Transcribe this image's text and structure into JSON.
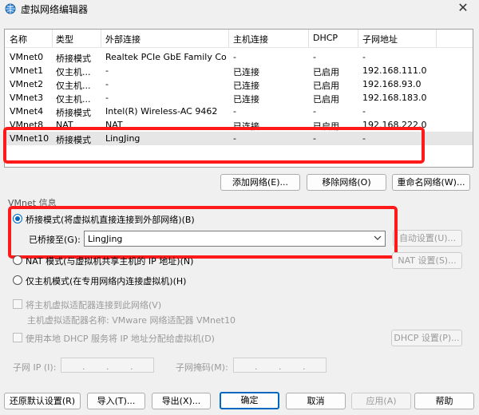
{
  "window": {
    "title": "虚拟网络编辑器",
    "icons": {
      "app": "network-globe-icon",
      "close": "close-icon"
    }
  },
  "table": {
    "headers": [
      "名称",
      "类型",
      "外部连接",
      "主机连接",
      "DHCP",
      "子网地址"
    ],
    "rows": [
      [
        "VMnet0",
        "桥接模式",
        "Realtek PCIe GbE Family Co...",
        "-",
        "-",
        "-"
      ],
      [
        "VMnet1",
        "仅主机...",
        "-",
        "已连接",
        "已启用",
        "192.168.111.0"
      ],
      [
        "VMnet2",
        "仅主机...",
        "-",
        "已连接",
        "已启用",
        "192.168.93.0"
      ],
      [
        "VMnet3",
        "仅主机...",
        "-",
        "已连接",
        "已启用",
        "192.168.183.0"
      ],
      [
        "VMnet4",
        "桥接模式",
        "Intel(R) Wireless-AC 9462",
        "-",
        "-",
        "-"
      ],
      [
        "VMnet8",
        "NAT",
        "NAT",
        "已连接",
        "已启用",
        "192.168.222.0"
      ],
      [
        "VMnet10",
        "桥接模式",
        "LingJing",
        "-",
        "-",
        "-"
      ]
    ],
    "selected_row": 6
  },
  "net_buttons": {
    "add": "添加网络(E)...",
    "remove": "移除网络(O)",
    "rename": "重命名网络(W)..."
  },
  "vmnet_info": {
    "section_label": "VMnet 信息",
    "bridged_label": "桥接模式(将虚拟机直接连接到外部网络)(B)",
    "bridged_to_label": "已桥接至(G):",
    "bridged_to_value": "LingJing",
    "auto_settings": "自动设置(U)...",
    "nat_label": "NAT 模式(与虚拟机共享主机的 IP 地址)(N)",
    "nat_settings": "NAT 设置(S)...",
    "hostonly_label": "仅主机模式(在专用网络内连接虚拟机)(H)",
    "connect_adapter_label": "将主机虚拟适配器连接到此网络(V)",
    "adapter_name_label": "主机虚拟适配器名称: VMware 网络适配器 VMnet10",
    "dhcp_label": "使用本地 DHCP 服务将 IP 地址分配给虚拟机(D)",
    "dhcp_settings": "DHCP 设置(P)...",
    "subnet_ip_label": "子网 IP (I):",
    "subnet_mask_label": "子网掩码(M):",
    "selected_mode": "bridged"
  },
  "footer": {
    "restore": "还原默认设置(R)",
    "import": "导入(T)...",
    "export": "导出(X)...",
    "ok": "确定",
    "cancel": "取消",
    "apply": "应用(A)",
    "help": "帮助"
  },
  "colors": {
    "highlight": "#ff1a1a",
    "accent": "#0067c0"
  }
}
